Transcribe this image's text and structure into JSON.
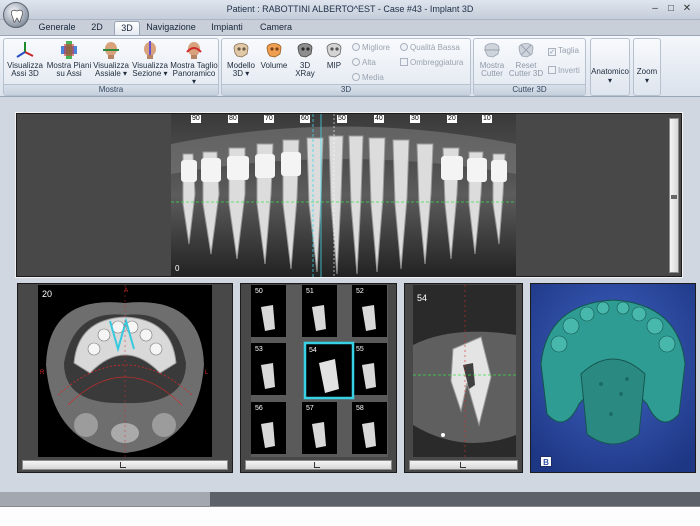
{
  "window": {
    "title": "Patient : RABOTTINI ALBERTO^EST - Case #43 - Implant 3D",
    "controls": [
      "minimize",
      "maximize",
      "close"
    ]
  },
  "tabs": [
    {
      "label": "Generale",
      "active": false
    },
    {
      "label": "2D",
      "active": false
    },
    {
      "label": "3D",
      "active": true
    },
    {
      "label": "Navigazione",
      "active": false
    },
    {
      "label": "Impianti",
      "active": false
    },
    {
      "label": "Camera",
      "active": false
    }
  ],
  "ribbon": {
    "mostra": {
      "label": "Mostra",
      "buttons": [
        {
          "line1": "Visualizza",
          "line2": "Assi 3D",
          "icon": "axes-icon"
        },
        {
          "line1": "Mostra Piani",
          "line2": "su Assi",
          "icon": "planes-icon"
        },
        {
          "line1": "Visualizza",
          "line2": "Assiale ▾",
          "icon": "axial-head-icon"
        },
        {
          "line1": "Visualizza",
          "line2": "Sezione ▾",
          "icon": "section-head-icon"
        },
        {
          "line1": "Mostra Taglio",
          "line2": "Panoramico ▾",
          "icon": "panoramic-head-icon"
        }
      ]
    },
    "three_d": {
      "label": "3D",
      "buttons": [
        {
          "line1": "Modello",
          "line2": "3D ▾",
          "icon": "skull-model-icon"
        },
        {
          "line1": "Volume",
          "line2": "",
          "icon": "skull-volume-icon"
        },
        {
          "line1": "3D",
          "line2": "XRay",
          "icon": "skull-xray-icon"
        },
        {
          "line1": "MIP",
          "line2": "",
          "icon": "skull-mip-icon"
        }
      ],
      "options": [
        "Migliore",
        "Alta",
        "Media",
        "Qualità Bassa",
        "Ombreggiatura"
      ]
    },
    "cutter": {
      "label": "Cutter 3D",
      "buttons": [
        {
          "line1": "Mostra",
          "line2": "Cutter",
          "icon": "cutter-icon"
        },
        {
          "line1": "Reset",
          "line2": "Cutter 3D",
          "icon": "reset-cutter-icon"
        }
      ],
      "options": [
        "Taglia",
        "Inverti"
      ]
    },
    "anatomico": {
      "label": "Anatomico",
      "arrow": "▾"
    },
    "zoom": {
      "label": "Zoom",
      "arrow": "▾"
    }
  },
  "panoramic": {
    "ruler": [
      "90",
      "80",
      "70",
      "60",
      "50",
      "40",
      "30",
      "20",
      "10"
    ],
    "corner_label": "0"
  },
  "axial": {
    "slice_number": "20",
    "markers": [
      "A",
      "R",
      "L"
    ]
  },
  "cross_sections": {
    "labels": [
      "50",
      "51",
      "52",
      "53",
      "54",
      "55",
      "56",
      "57",
      "58"
    ],
    "selected": "54"
  },
  "section_detail": {
    "slice_number": "54"
  },
  "model_3d": {
    "label": "B"
  }
}
